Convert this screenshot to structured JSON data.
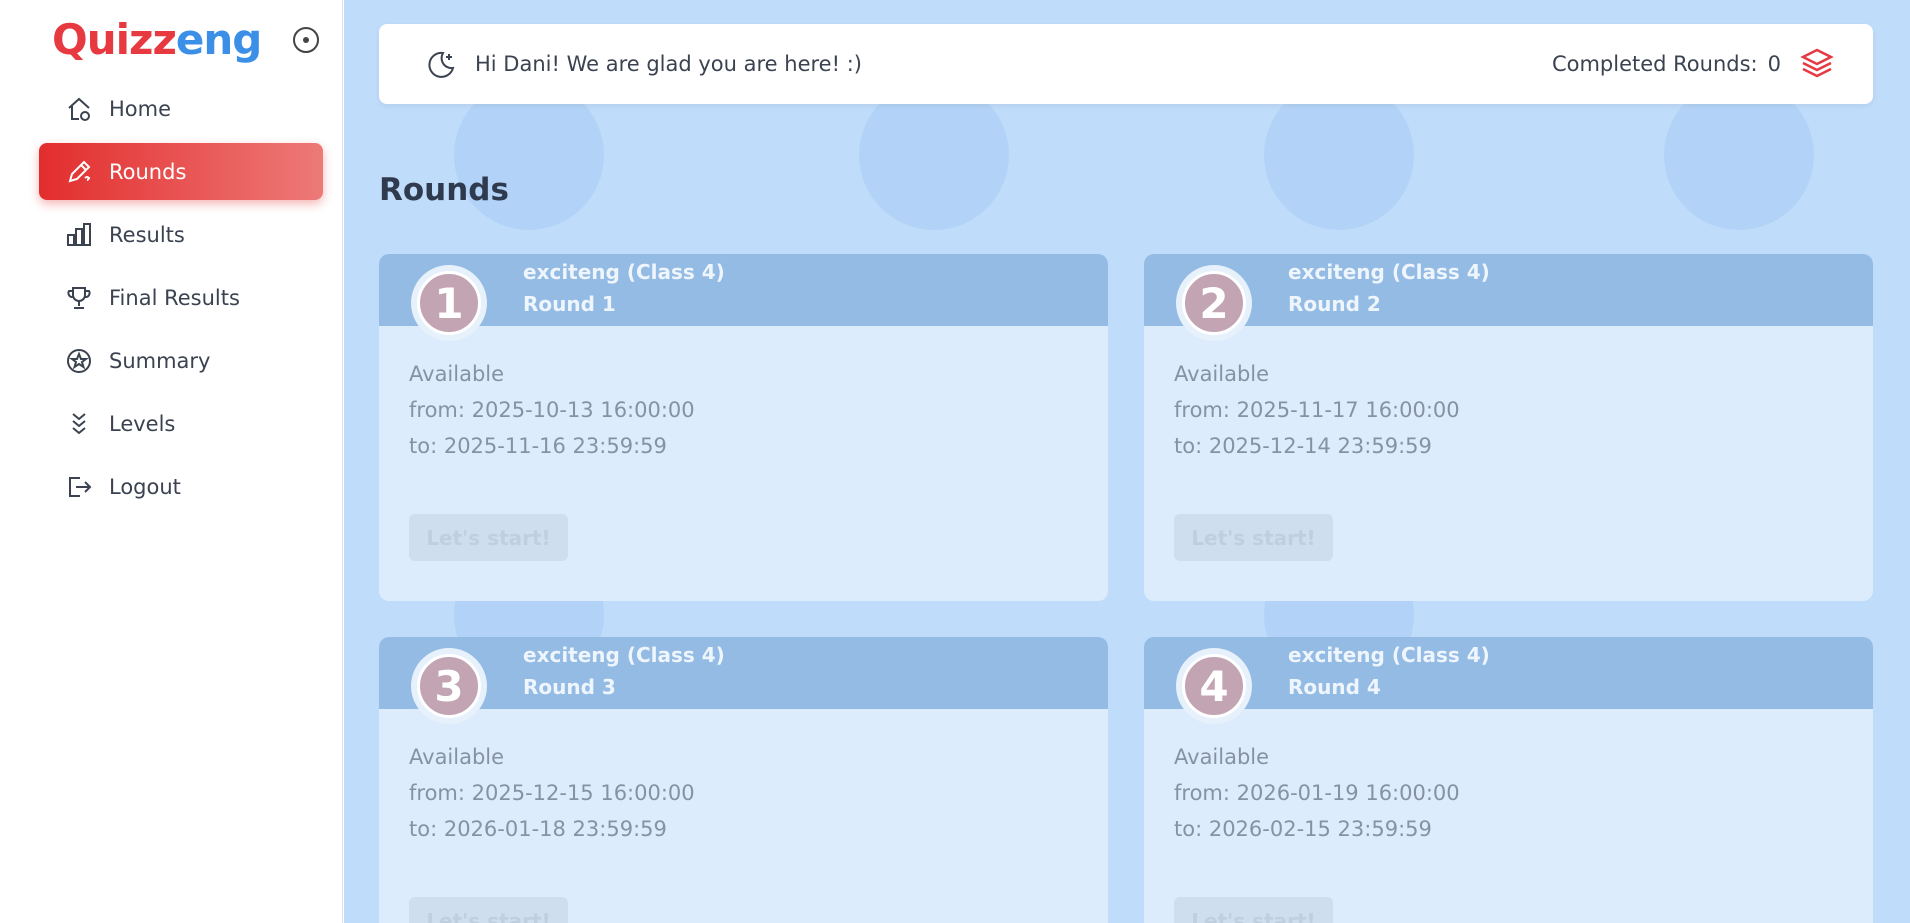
{
  "sidebar": {
    "logo": {
      "q": "Q",
      "red": "uizz",
      "blue": "eng"
    },
    "items": [
      {
        "label": "Home",
        "icon": "home-icon",
        "active": false
      },
      {
        "label": "Rounds",
        "icon": "pencil-icon",
        "active": true
      },
      {
        "label": "Results",
        "icon": "bar-chart-icon",
        "active": false
      },
      {
        "label": "Final Results",
        "icon": "trophy-icon",
        "active": false
      },
      {
        "label": "Summary",
        "icon": "star-circle-icon",
        "active": false
      },
      {
        "label": "Levels",
        "icon": "chevrons-down-icon",
        "active": false
      },
      {
        "label": "Logout",
        "icon": "logout-icon",
        "active": false
      }
    ]
  },
  "header": {
    "greeting": "Hi Dani! We are glad you are here! :)",
    "completed_label": "Completed Rounds:",
    "completed_value": "0"
  },
  "main": {
    "title": "Rounds",
    "rounds": [
      {
        "number": "1",
        "class": "exciteng (Class 4)",
        "round": "Round 1",
        "available": "Available",
        "from": "from: 2025-10-13 16:00:00",
        "to": "to: 2025-11-16 23:59:59",
        "button": "Let's start!"
      },
      {
        "number": "2",
        "class": "exciteng (Class 4)",
        "round": "Round 2",
        "available": "Available",
        "from": "from: 2025-11-17 16:00:00",
        "to": "to: 2025-12-14 23:59:59",
        "button": "Let's start!"
      },
      {
        "number": "3",
        "class": "exciteng (Class 4)",
        "round": "Round 3",
        "available": "Available",
        "from": "from: 2025-12-15 16:00:00",
        "to": "to: 2026-01-18 23:59:59",
        "button": "Let's start!"
      },
      {
        "number": "4",
        "class": "exciteng (Class 4)",
        "round": "Round 4",
        "available": "Available",
        "from": "from: 2026-01-19 16:00:00",
        "to": "to: 2026-02-15 23:59:59",
        "button": "Let's start!"
      }
    ]
  },
  "colors": {
    "accent": "#e32d2d",
    "brand_blue": "#3b8fe6",
    "background": "#bfdcfa",
    "card_header": "#94bbe4"
  }
}
